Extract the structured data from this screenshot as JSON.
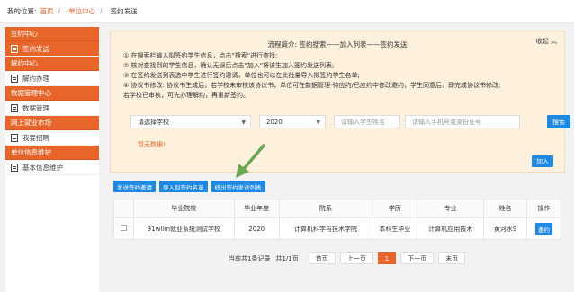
{
  "breadcrumb": {
    "location_label": "我的位置:",
    "items": [
      "首页",
      "单位中心",
      "签约发送"
    ]
  },
  "sidebar": {
    "sections": [
      {
        "title": "签约中心",
        "items": [
          {
            "label": "签约发送",
            "active": true
          }
        ]
      },
      {
        "title": "解约中心",
        "items": [
          {
            "label": "解约办理",
            "active": false
          }
        ]
      },
      {
        "title": "数据管理中心",
        "items": [
          {
            "label": "数据管理",
            "active": false
          }
        ]
      },
      {
        "title": "网上就业市场",
        "items": [
          {
            "label": "我要招聘",
            "active": false
          }
        ]
      },
      {
        "title": "单位信息维护",
        "items": [
          {
            "label": "基本信息维护",
            "active": false
          }
        ]
      }
    ]
  },
  "guide": {
    "title": "流程简介: 签约搜索——加入列表——签约发送",
    "collapse_label": "收起 ︽",
    "lines": [
      "① 在搜索栏输入拟签约学生信息，点击\"搜索\"进行查找;",
      "② 核对查找到的学生信息，确认无误后点击\"加入\"将该生加入签约发送列表;",
      "③ 在签约发送列表选中学生进行签约邀请，单位也可以在此批量导入拟签约学生名单;",
      "④ 协议书修改: 协议书生成后，若学校未审核该协议书，单位可在数据管理-待应约/已应约中修改邀约，学生同意后，即完成协议书修改;",
      "若学校已审核，可先办理解约，再重新签约。"
    ]
  },
  "search": {
    "school_select": "请选择学校",
    "year_select": "2020",
    "name_placeholder": "请输入学生姓名",
    "phone_placeholder": "请输入手机号或身份证号",
    "search_button": "搜索",
    "no_data": "暂无数据!",
    "add_button": "加入"
  },
  "actions": {
    "send_invite": "发送签约邀请",
    "import_list": "导入拟签约名单",
    "export_list": "修出签约发送列表"
  },
  "table": {
    "headers": [
      "",
      "毕业院校",
      "毕业年度",
      "院系",
      "学历",
      "专业",
      "姓名",
      "操作"
    ],
    "rows": [
      {
        "school": "91wllm就业系统测试学校",
        "year": "2020",
        "department": "计算机科学与技术学院",
        "degree": "本科生毕业",
        "major": "计算机应用技术",
        "name": "黄河水9",
        "action": "邀约"
      }
    ]
  },
  "pagination": {
    "summary": "当前共1条记录",
    "page_info": "共1/1页",
    "first": "首页",
    "prev": "上一页",
    "current": "1",
    "next": "下一页",
    "last": "末页"
  },
  "colors": {
    "accent": "#e8652a",
    "primary_button": "#1e88e5",
    "guide_bg": "#fdf0dc",
    "arrow": "#6aa84f"
  }
}
